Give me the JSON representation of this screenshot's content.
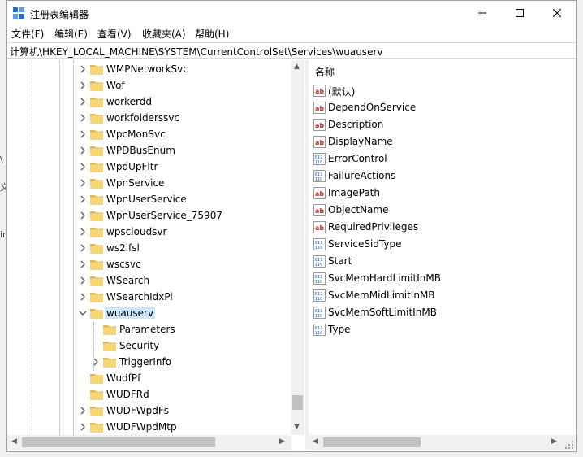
{
  "window": {
    "title": "注册表编辑器"
  },
  "menu": [
    "文件(F)",
    "编辑(E)",
    "查看(V)",
    "收藏夹(A)",
    "帮助(H)"
  ],
  "address": "计算机\\HKEY_LOCAL_MACHINE\\SYSTEM\\CurrentControlSet\\Services\\wuauserv",
  "tree": {
    "items": [
      {
        "label": "WMPNetworkSvc",
        "level": 0,
        "expander": "collapsed"
      },
      {
        "label": "Wof",
        "level": 0,
        "expander": "collapsed"
      },
      {
        "label": "workerdd",
        "level": 0,
        "expander": "collapsed"
      },
      {
        "label": "workfolderssvc",
        "level": 0,
        "expander": "collapsed"
      },
      {
        "label": "WpcMonSvc",
        "level": 0,
        "expander": "collapsed"
      },
      {
        "label": "WPDBusEnum",
        "level": 0,
        "expander": "collapsed"
      },
      {
        "label": "WpdUpFltr",
        "level": 0,
        "expander": "collapsed"
      },
      {
        "label": "WpnService",
        "level": 0,
        "expander": "collapsed"
      },
      {
        "label": "WpnUserService",
        "level": 0,
        "expander": "collapsed"
      },
      {
        "label": "WpnUserService_75907",
        "level": 0,
        "expander": "collapsed"
      },
      {
        "label": "wpscloudsvr",
        "level": 0,
        "expander": "collapsed"
      },
      {
        "label": "ws2ifsl",
        "level": 0,
        "expander": "collapsed"
      },
      {
        "label": "wscsvc",
        "level": 0,
        "expander": "collapsed"
      },
      {
        "label": "WSearch",
        "level": 0,
        "expander": "collapsed"
      },
      {
        "label": "WSearchIdxPi",
        "level": 0,
        "expander": "collapsed"
      },
      {
        "label": "wuauserv",
        "level": 0,
        "expander": "expanded",
        "selected": true
      },
      {
        "label": "Parameters",
        "level": 1,
        "expander": "none"
      },
      {
        "label": "Security",
        "level": 1,
        "expander": "none"
      },
      {
        "label": "TriggerInfo",
        "level": 1,
        "expander": "collapsed"
      },
      {
        "label": "WudfPf",
        "level": 0,
        "expander": "none"
      },
      {
        "label": "WUDFRd",
        "level": 0,
        "expander": "none"
      },
      {
        "label": "WUDFWpdFs",
        "level": 0,
        "expander": "collapsed"
      },
      {
        "label": "WUDFWpdMtp",
        "level": 0,
        "expander": "collapsed"
      }
    ]
  },
  "values": {
    "column_name": "名称",
    "items": [
      {
        "name": "(默认)",
        "type": "string"
      },
      {
        "name": "DependOnService",
        "type": "string"
      },
      {
        "name": "Description",
        "type": "string"
      },
      {
        "name": "DisplayName",
        "type": "string"
      },
      {
        "name": "ErrorControl",
        "type": "binary"
      },
      {
        "name": "FailureActions",
        "type": "binary"
      },
      {
        "name": "ImagePath",
        "type": "string"
      },
      {
        "name": "ObjectName",
        "type": "string"
      },
      {
        "name": "RequiredPrivileges",
        "type": "string"
      },
      {
        "name": "ServiceSidType",
        "type": "binary"
      },
      {
        "name": "Start",
        "type": "binary"
      },
      {
        "name": "SvcMemHardLimitInMB",
        "type": "binary"
      },
      {
        "name": "SvcMemMidLimitInMB",
        "type": "binary"
      },
      {
        "name": "SvcMemSoftLimitInMB",
        "type": "binary"
      },
      {
        "name": "Type",
        "type": "binary"
      }
    ]
  },
  "colors": {
    "selection": "#cce8ff",
    "folder": "#f8d775",
    "folder_dark": "#e0b94c",
    "string_icon_red": "#c0392b",
    "binary_icon_blue": "#1f5fbf",
    "app_icon_blue": "#1e73d2"
  },
  "outside": {
    "fragments": [
      "\\",
      "文",
      "ir"
    ]
  }
}
